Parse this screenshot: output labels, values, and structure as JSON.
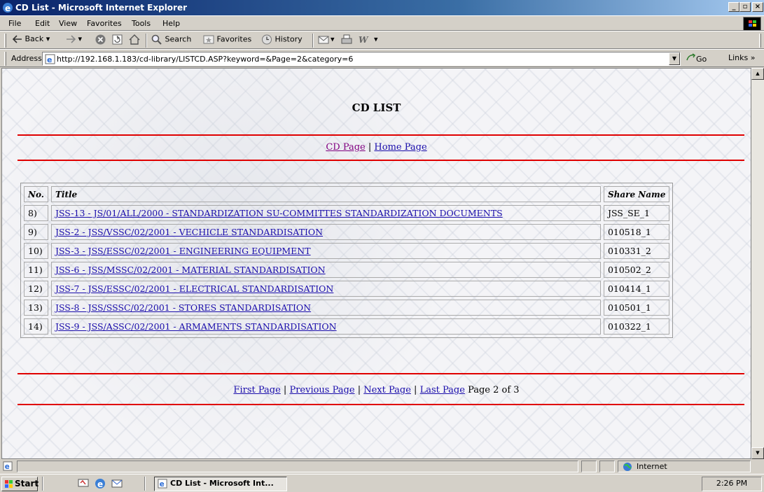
{
  "window": {
    "title": "CD List - Microsoft Internet Explorer"
  },
  "menu": [
    "File",
    "Edit",
    "View",
    "Favorites",
    "Tools",
    "Help"
  ],
  "toolbar": {
    "back": "Back",
    "search": "Search",
    "favorites": "Favorites",
    "history": "History"
  },
  "address": {
    "label": "Address",
    "url": "http://192.168.1.183/cd-library/LISTCD.ASP?keyword=&Page=2&category=6",
    "go": "Go",
    "links": "Links"
  },
  "page": {
    "title": "CD LIST",
    "nav": {
      "cd_page": "CD Page",
      "sep": "|",
      "home_page": "Home Page"
    },
    "table": {
      "headers": {
        "no": "No.",
        "title": "Title",
        "share": "Share Name"
      },
      "rows": [
        {
          "no": "8)",
          "title": "JSS-13 - JS/01/ALL/2000 - STANDARDIZATION SU-COMMITTES STANDARDIZATION DOCUMENTS",
          "share": "JSS_SE_1"
        },
        {
          "no": "9)",
          "title": "JSS-2 - JSS/VSSC/02/2001 - VECHICLE STANDARDISATION",
          "share": "010518_1"
        },
        {
          "no": "10)",
          "title": "JSS-3 - JSS/ESSC/02/2001 - ENGINEERING EQUIPMENT",
          "share": "010331_2"
        },
        {
          "no": "11)",
          "title": "JSS-6 - JSS/MSSC/02/2001 - MATERIAL STANDARDISATION",
          "share": "010502_2"
        },
        {
          "no": "12)",
          "title": "JSS-7 - JSS/ESSC/02/2001 - ELECTRICAL STANDARDISATION",
          "share": "010414_1"
        },
        {
          "no": "13)",
          "title": "JSS-8 - JSS/SSSC/02/2001 - STORES STANDARDISATION",
          "share": "010501_1"
        },
        {
          "no": "14)",
          "title": "JSS-9 - JSS/ASSC/02/2001 - ARMAMENTS STANDARDISATION",
          "share": "010322_1"
        }
      ]
    },
    "pager": {
      "first": "First Page",
      "previous": "Previous Page",
      "next": "Next Page",
      "last": "Last Page",
      "sep": "|",
      "status": "Page 2 of 3"
    }
  },
  "statusbar": {
    "zone": "Internet"
  },
  "taskbar": {
    "start": "Start",
    "task": "CD List - Microsoft Int...",
    "clock": "2:26 PM"
  },
  "colors": {
    "rule": "#e00000",
    "link": "#1a0dab",
    "visited": "#800080",
    "titlebar": "#0a246a"
  },
  "icons": [
    "ie-icon",
    "minimize-icon",
    "maximize-icon",
    "close-icon",
    "windows-logo-icon",
    "back-arrow-icon",
    "forward-arrow-icon",
    "stop-icon",
    "refresh-icon",
    "home-icon",
    "search-icon",
    "favorites-icon",
    "history-icon",
    "mail-icon",
    "print-icon",
    "edit-icon",
    "page-icon",
    "go-arrow-icon",
    "scroll-up-icon",
    "scroll-down-icon",
    "globe-icon",
    "start-flag-icon"
  ]
}
